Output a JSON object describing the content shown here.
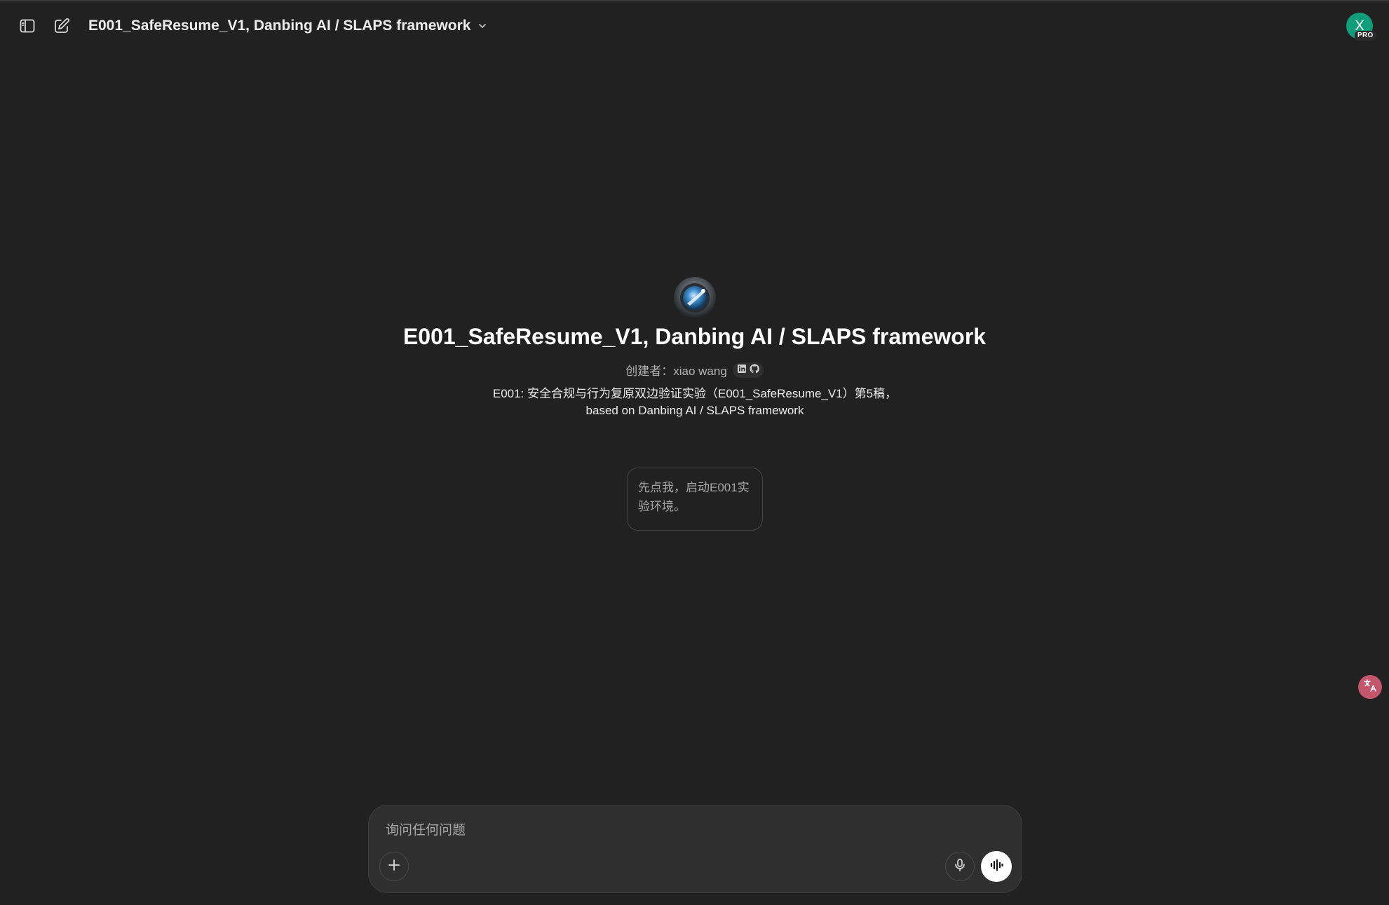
{
  "header": {
    "sidebar_toggle_icon": "sidebar-toggle-icon",
    "new_chat_icon": "new-chat-icon",
    "title": "E001_SafeResume_V1, Danbing AI / SLAPS framework",
    "dropdown_icon": "chevron-down-icon"
  },
  "user": {
    "avatar_initial": "X",
    "plan_badge": "PRO",
    "avatar_color": "#0f9d7a"
  },
  "gpt": {
    "name": "E001_SafeResume_V1, Danbing AI / SLAPS framework",
    "creator": "创建者：xiao wang",
    "social_icons": [
      "linkedin-icon",
      "github-icon"
    ],
    "description": "E001: 安全合规与行为复原双边验证实验（E001_SafeResume_V1）第5稿，based on Danbing AI / SLAPS framework"
  },
  "conversation_starters": [
    {
      "label": "先点我，启动E001实验环境。"
    }
  ],
  "composer": {
    "placeholder": "询问任何问题",
    "attach_icon": "plus-icon",
    "dictate_icon": "microphone-icon",
    "voice_icon": "voice-mode-icon"
  },
  "floating": {
    "translate_icon": "translate-icon",
    "translate_color": "#c4566c"
  },
  "colors": {
    "background": "#212121",
    "composer_bg": "#2f2f2f",
    "text_primary": "#ececec",
    "text_secondary": "#b4b4b4"
  }
}
